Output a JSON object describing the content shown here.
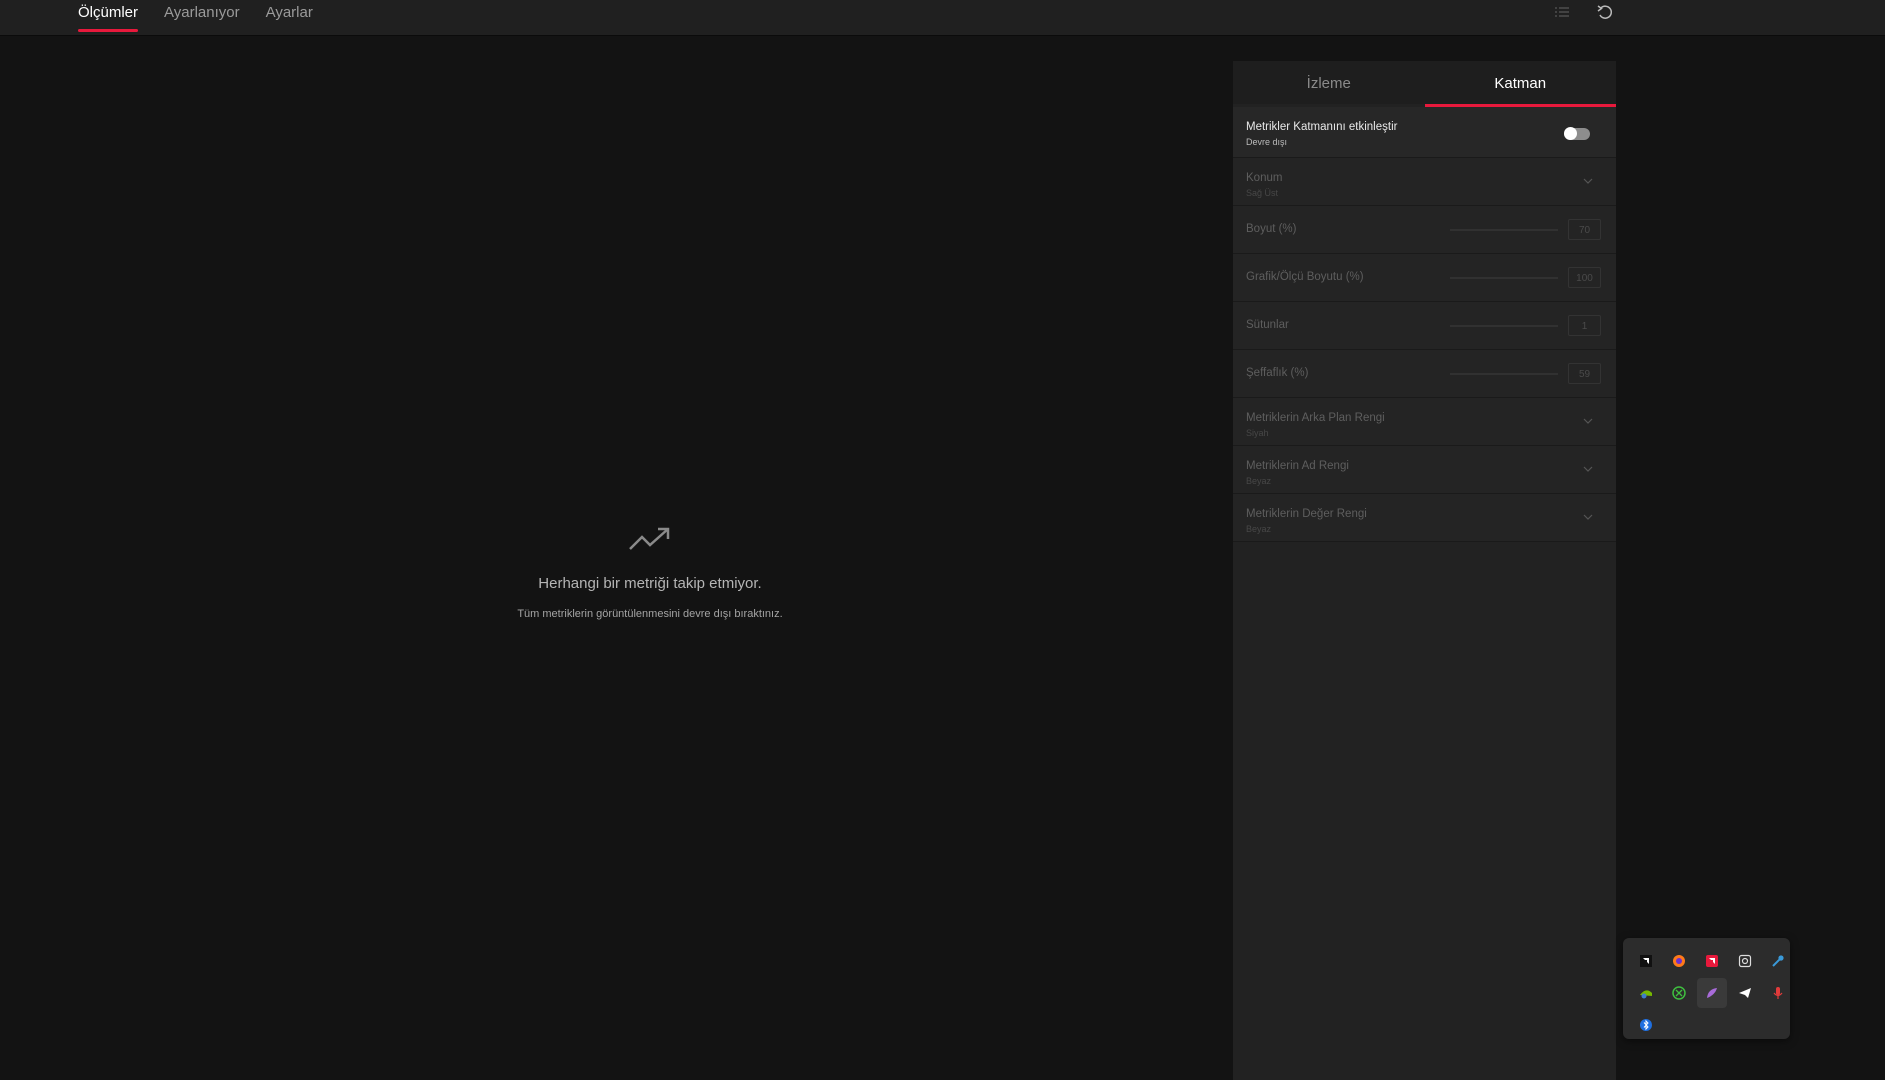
{
  "topbar": {
    "tabs": [
      {
        "label": "Ölçümler"
      },
      {
        "label": "Ayarlanıyor"
      },
      {
        "label": "Ayarlar"
      }
    ],
    "icons": [
      "list-icon",
      "reset-icon"
    ]
  },
  "empty_state": {
    "icon": "trending-up-icon",
    "title": "Herhangi bir metriği takip etmiyor.",
    "subtitle": "Tüm metriklerin görüntülenmesini devre dışı bıraktınız."
  },
  "panel": {
    "tabs": [
      {
        "label": "İzleme"
      },
      {
        "label": "Katman"
      }
    ],
    "enable": {
      "label": "Metrikler Katmanını etkinleştir",
      "status": "Devre dışı",
      "on": false
    },
    "position": {
      "label": "Konum",
      "value": "Sağ Üst"
    },
    "sliders": [
      {
        "label": "Boyut (%)",
        "value": "70",
        "fraction": 0.7
      },
      {
        "label": "Grafik/Ölçü Boyutu (%)",
        "value": "100",
        "fraction": 1.0
      },
      {
        "label": "Sütunlar",
        "value": "1",
        "fraction": 0.0
      },
      {
        "label": "Şeffaflık (%)",
        "value": "59",
        "fraction": 0.59
      }
    ],
    "dropdowns": [
      {
        "label": "Metriklerin Arka Plan Rengi",
        "value": "Siyah"
      },
      {
        "label": "Metriklerin Ad Rengi",
        "value": "Beyaz"
      },
      {
        "label": "Metriklerin Değer Rengi",
        "value": "Beyaz"
      }
    ]
  },
  "tray": {
    "icons": [
      "amd-icon",
      "firefox-icon",
      "amd-software-icon",
      "screenshot-icon",
      "steam-icon",
      "nvidia-icon",
      "xbox-icon",
      "feather-icon",
      "telegram-icon",
      "microphone-icon",
      "bluetooth-icon"
    ]
  },
  "colors": {
    "accent": "#e8193c",
    "background": "#131313",
    "panel": "#222222"
  }
}
